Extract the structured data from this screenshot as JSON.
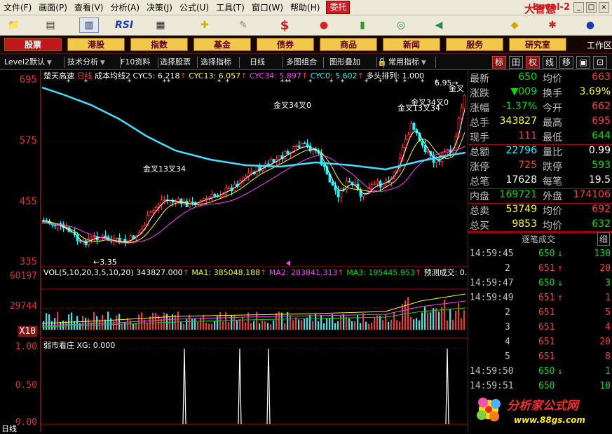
{
  "menu": [
    "文件(F)",
    "画面(P)",
    "查看(V)",
    "分析(A)",
    "决策(J)",
    "公式(U)",
    "工具(T)",
    "窗口(W)",
    "帮助(H)"
  ],
  "entrust": "委托",
  "brand": {
    "name": "大智慧",
    "edition": "Level-2"
  },
  "toolbar_icons": [
    "folder-icon",
    "chart-icon",
    "kline-icon",
    "rsi-icon",
    "table-icon",
    "cross-icon",
    "ruler-icon",
    "dollar-icon",
    "traffic-icon",
    "bars-icon",
    "binoculars-icon",
    "megaphone-icon",
    "diamond-icon",
    "gear-icon",
    "refresh-icon"
  ],
  "toolbar_rsi": "RSI",
  "toolbar_dollar": "$",
  "categories": [
    "股票",
    "港股",
    "指数",
    "基金",
    "债券",
    "商品",
    "新闻",
    "服务",
    "研究室"
  ],
  "work_area": "工作区",
  "subtools": [
    "Level2默认",
    "技术分析",
    "F10资料",
    "选择股票",
    "选择指标",
    "日线",
    "多图组合",
    "图形叠加",
    "常用指标"
  ],
  "right_tabs": [
    "标",
    "田",
    "权",
    "线",
    "移",
    "▣",
    "⊡"
  ],
  "main_header": {
    "stock": "楚天高速",
    "period": "日线",
    "indicator": "成本均线2",
    "cyc5": "CYC5: 6.218",
    "cyc13": "CYC13: 6.057",
    "cyc34": "CYC34: 5.897",
    "cyc0": "CYC0: 5.602",
    "duotou": "多头排列: 1.000"
  },
  "vol_header": {
    "name": "VOL(5,10,20,3,5,10,20)",
    "vol": "343827.000",
    "ma1": "MA1: 385048.188",
    "ma2": "MA2: 283841.313",
    "ma3": "MA3: 195445.953",
    "pred": "预测成交: 0."
  },
  "ind_header": {
    "name": "弱市看庄",
    "xg": "XG: 0.000"
  },
  "y_axis": {
    "main": [
      "695",
      "575",
      "455",
      "335"
    ],
    "vol": [
      "60197",
      "29744",
      "X10"
    ],
    "ind": [
      "1.00",
      "0.50",
      "0.00"
    ]
  },
  "annotations": {
    "low": "3.35",
    "high": "6.95",
    "cross1": "金叉13叉34",
    "cross2": "金叉34叉0",
    "cross3": "金叉13叉34",
    "cross4": "金叉34叉0",
    "cross5": "金叉"
  },
  "quote": [
    {
      "k": "最新",
      "v": "650",
      "vc": "grn",
      "k2": "均价",
      "v2": "663",
      "v2c": "red"
    },
    {
      "k": "涨跌",
      "v": "▼009",
      "vc": "grn",
      "k2": "换手",
      "v2": "3.69%",
      "v2c": "yel"
    },
    {
      "k": "涨幅",
      "v": "-1.37%",
      "vc": "grn",
      "k2": "今开",
      "v2": "662",
      "v2c": "red"
    },
    {
      "k": "总手",
      "v": "343827",
      "vc": "yel",
      "k2": "最高",
      "v2": "695",
      "v2c": "red"
    },
    {
      "k": "现手",
      "v": "111",
      "vc": "red",
      "k2": "最低",
      "v2": "644",
      "v2c": "grn"
    },
    {
      "k": "总额",
      "v": "22796",
      "vc": "cyn",
      "k2": "量比",
      "v2": "0.99",
      "v2c": "wht"
    },
    {
      "k": "涨停",
      "v": "725",
      "vc": "red",
      "k2": "跌停",
      "v2": "593",
      "v2c": "grn"
    },
    {
      "k": "总笔",
      "v": "17628",
      "vc": "wht",
      "k2": "每笔",
      "v2": "19.5",
      "v2c": "wht"
    },
    {
      "k": "内盘",
      "v": "169721",
      "vc": "grn",
      "k2": "外盘",
      "v2": "174106",
      "v2c": "red"
    },
    {
      "k": "总卖",
      "v": "53749",
      "vc": "yel",
      "k2": "均价",
      "v2": "692",
      "v2c": "red"
    },
    {
      "k": "总买",
      "v": "9853",
      "vc": "yel",
      "k2": "均价",
      "v2": "632",
      "v2c": "grn"
    }
  ],
  "tick_header": "逐笔成交",
  "tick_tab": "细",
  "ticks": [
    {
      "t": "14:59:45",
      "p": "650",
      "d": "↓",
      "pc": "grn",
      "a": "130",
      "ac": "grn"
    },
    {
      "t": "2",
      "p": "651",
      "d": "↑",
      "pc": "red",
      "a": "20",
      "ac": "red"
    },
    {
      "t": "14:59:47",
      "p": "650",
      "d": "↓",
      "pc": "grn",
      "a": "3",
      "ac": "grn"
    },
    {
      "t": "14:59:49",
      "p": "651",
      "d": "↑",
      "pc": "red",
      "a": "1",
      "ac": "red"
    },
    {
      "t": "2",
      "p": "651",
      "d": "",
      "pc": "red",
      "a": "5",
      "ac": "red"
    },
    {
      "t": "3",
      "p": "651",
      "d": "",
      "pc": "red",
      "a": "4",
      "ac": "red"
    },
    {
      "t": "4",
      "p": "651",
      "d": "",
      "pc": "red",
      "a": "20",
      "ac": "red"
    },
    {
      "t": "5",
      "p": "651",
      "d": "",
      "pc": "red",
      "a": "8",
      "ac": "red"
    },
    {
      "t": "14:59:50",
      "p": "650",
      "d": "↓",
      "pc": "grn",
      "a": "1",
      "ac": "grn"
    },
    {
      "t": "14:59:51",
      "p": "650",
      "d": "",
      "pc": "grn",
      "a": "10",
      "ac": "grn"
    }
  ],
  "watermark": {
    "name": "分析家公式网",
    "url": "www.88gs.com"
  },
  "bottom_label": "日线"
}
